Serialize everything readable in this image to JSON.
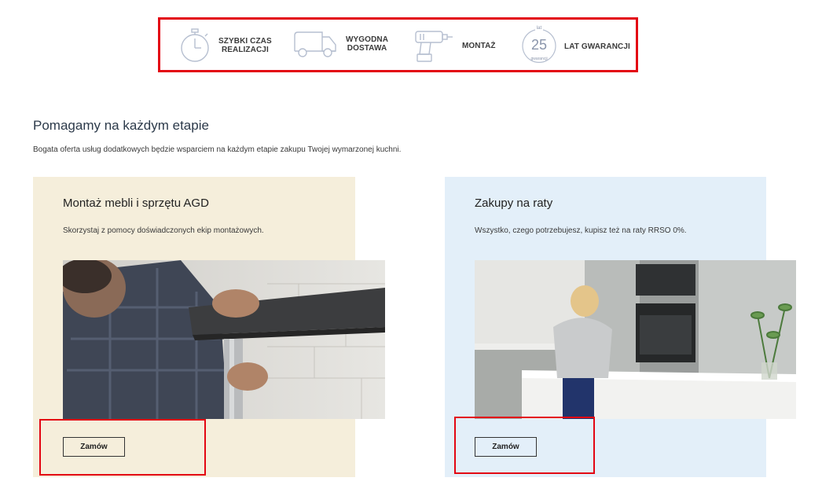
{
  "features": [
    {
      "icon": "stopwatch-icon",
      "label_line1": "SZYBKI CZAS",
      "label_line2": "REALIZACJI"
    },
    {
      "icon": "delivery-van-icon",
      "label_line1": "WYGODNA",
      "label_line2": "DOSTAWA"
    },
    {
      "icon": "drill-icon",
      "label_line1": "MONTAŻ",
      "label_line2": ""
    },
    {
      "icon": "warranty-badge-icon",
      "label_line1": "LAT GWARANCJI",
      "label_line2": "",
      "badge_number": "25",
      "badge_top": "lat",
      "badge_bottom": "gwarancji"
    }
  ],
  "section": {
    "title": "Pomagamy na każdym etapie",
    "description": "Bogata oferta usług dodatkowych będzie wsparciem na każdym etapie zakupu Twojej wymarzonej kuchni."
  },
  "cards": [
    {
      "title": "Montaż mebli i sprzętu AGD",
      "description": "Skorzystaj z pomocy doświadczonych ekip montażowych.",
      "button": "Zamów",
      "bg": "#f5eedb"
    },
    {
      "title": "Zakupy na raty",
      "description": "Wszystko, czego potrzebujesz, kupisz też na raty RRSO 0%.",
      "button": "Zamów",
      "bg": "#e3eff9"
    }
  ],
  "colors": {
    "highlight": "#e30613",
    "icon_stroke": "#b6bfd0"
  }
}
